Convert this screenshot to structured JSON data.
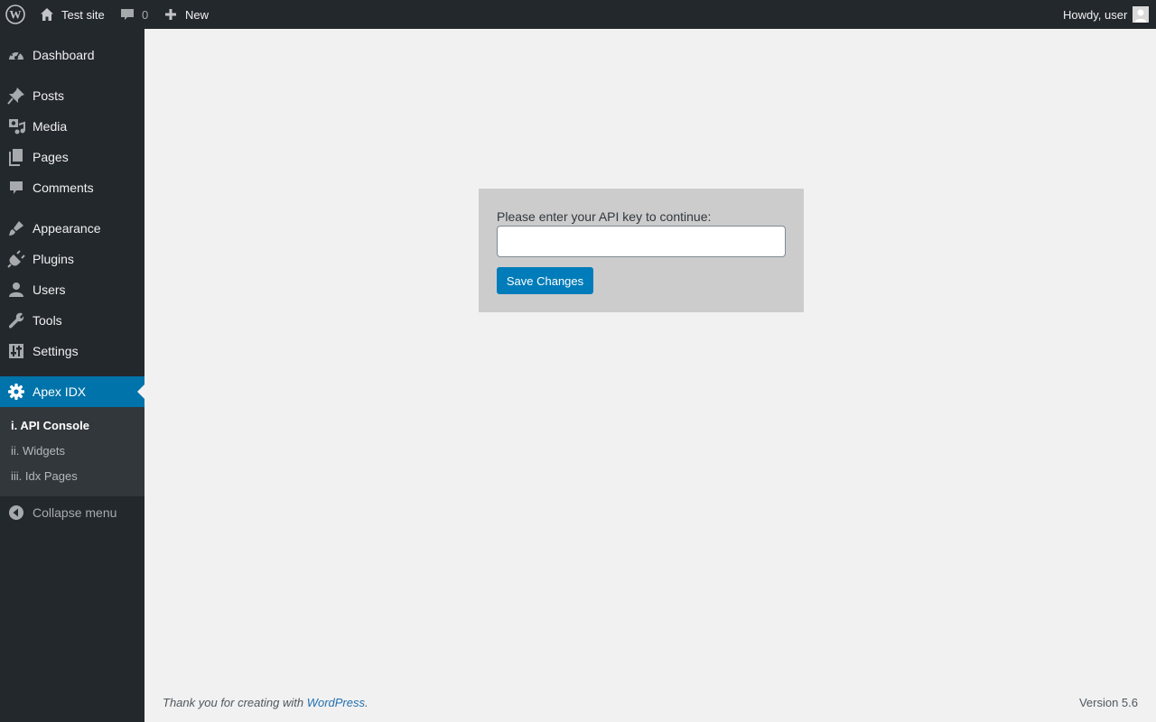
{
  "adminbar": {
    "site_name": "Test site",
    "comments_count": "0",
    "new_label": "New",
    "howdy": "Howdy, user"
  },
  "sidebar": {
    "items": [
      {
        "label": "Dashboard",
        "icon": "dashboard-icon"
      },
      {
        "label": "Posts",
        "icon": "pin-icon"
      },
      {
        "label": "Media",
        "icon": "media-icon"
      },
      {
        "label": "Pages",
        "icon": "pages-icon"
      },
      {
        "label": "Comments",
        "icon": "comment-icon"
      },
      {
        "label": "Appearance",
        "icon": "brush-icon"
      },
      {
        "label": "Plugins",
        "icon": "plugin-icon"
      },
      {
        "label": "Users",
        "icon": "user-icon"
      },
      {
        "label": "Tools",
        "icon": "wrench-icon"
      },
      {
        "label": "Settings",
        "icon": "settings-icon"
      },
      {
        "label": "Apex IDX",
        "icon": "gear-icon"
      }
    ],
    "submenu": [
      "i. API Console",
      "ii. Widgets",
      "iii. Idx Pages"
    ],
    "collapse_label": "Collapse menu"
  },
  "main": {
    "prompt_label": "Please enter your API key to continue:",
    "api_key_value": "",
    "save_label": "Save Changes"
  },
  "footer": {
    "thanks_prefix": "Thank you for creating with ",
    "wordpress_link": "WordPress",
    "thanks_suffix": ".",
    "version": "Version 5.6"
  },
  "colors": {
    "accent": "#0073aa",
    "button": "#007cba",
    "bar_bg": "#23282d"
  }
}
